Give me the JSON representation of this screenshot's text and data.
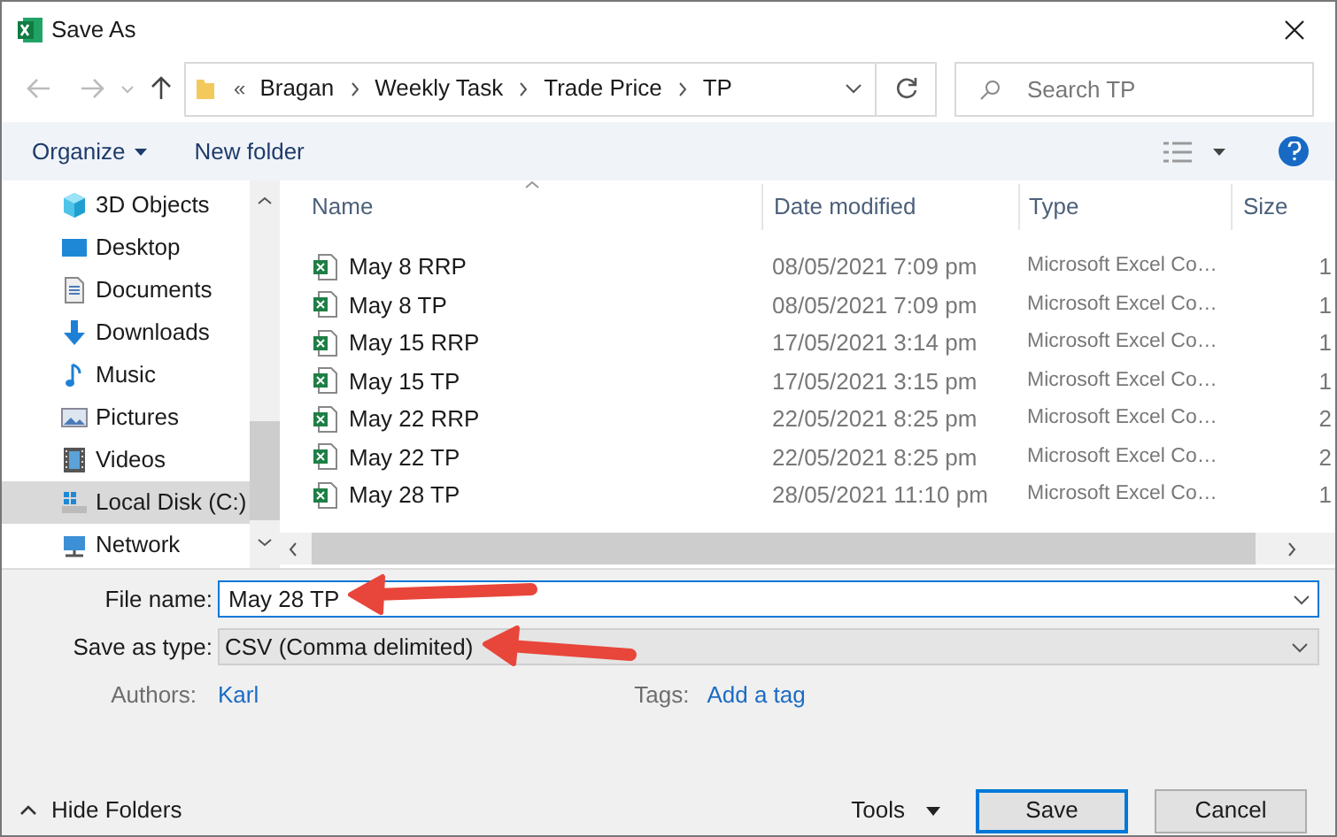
{
  "window": {
    "title": "Save As"
  },
  "address_bar": {
    "overflow": "«",
    "path": [
      "Bragan",
      "Weekly Task",
      "Trade Price",
      "TP"
    ]
  },
  "search": {
    "placeholder": "Search TP"
  },
  "toolbar": {
    "organize": "Organize",
    "new_folder": "New folder"
  },
  "sidebar": {
    "items": [
      {
        "label": "3D Objects",
        "kind": "cube",
        "selected": false
      },
      {
        "label": "Desktop",
        "kind": "desktop",
        "selected": false
      },
      {
        "label": "Documents",
        "kind": "documents",
        "selected": false
      },
      {
        "label": "Downloads",
        "kind": "downloads",
        "selected": false
      },
      {
        "label": "Music",
        "kind": "music",
        "selected": false
      },
      {
        "label": "Pictures",
        "kind": "pictures",
        "selected": false
      },
      {
        "label": "Videos",
        "kind": "videos",
        "selected": false
      },
      {
        "label": "Local Disk (C:)",
        "kind": "drive",
        "selected": true
      },
      {
        "label": "Network",
        "kind": "network",
        "selected": false
      }
    ]
  },
  "file_list": {
    "columns": [
      "Name",
      "Date modified",
      "Type",
      "Size"
    ],
    "rows": [
      {
        "name": "May 8 RRP",
        "date": "08/05/2021 7:09 pm",
        "type": "Microsoft Excel Co…",
        "size": "1"
      },
      {
        "name": "May 8 TP",
        "date": "08/05/2021 7:09 pm",
        "type": "Microsoft Excel Co…",
        "size": "1"
      },
      {
        "name": "May 15 RRP",
        "date": "17/05/2021 3:14 pm",
        "type": "Microsoft Excel Co…",
        "size": "1"
      },
      {
        "name": "May 15 TP",
        "date": "17/05/2021 3:15 pm",
        "type": "Microsoft Excel Co…",
        "size": "1"
      },
      {
        "name": "May 22 RRP",
        "date": "22/05/2021 8:25 pm",
        "type": "Microsoft Excel Co…",
        "size": "2"
      },
      {
        "name": "May 22 TP",
        "date": "22/05/2021 8:25 pm",
        "type": "Microsoft Excel Co…",
        "size": "2"
      },
      {
        "name": "May 28 TP",
        "date": "28/05/2021 11:10 pm",
        "type": "Microsoft Excel Co…",
        "size": "1"
      }
    ]
  },
  "form": {
    "file_name": {
      "label": "File name:",
      "value": "May 28 TP"
    },
    "save_as_type": {
      "label": "Save as type:",
      "value": "CSV (Comma delimited)"
    },
    "authors": {
      "label": "Authors:",
      "value": "Karl"
    },
    "tags": {
      "label": "Tags:",
      "value": "Add a tag"
    }
  },
  "footer": {
    "hide_folders": "Hide Folders",
    "tools": "Tools",
    "buttons": [
      {
        "label": "Save",
        "default": true
      },
      {
        "label": "Cancel",
        "default": false
      }
    ]
  }
}
